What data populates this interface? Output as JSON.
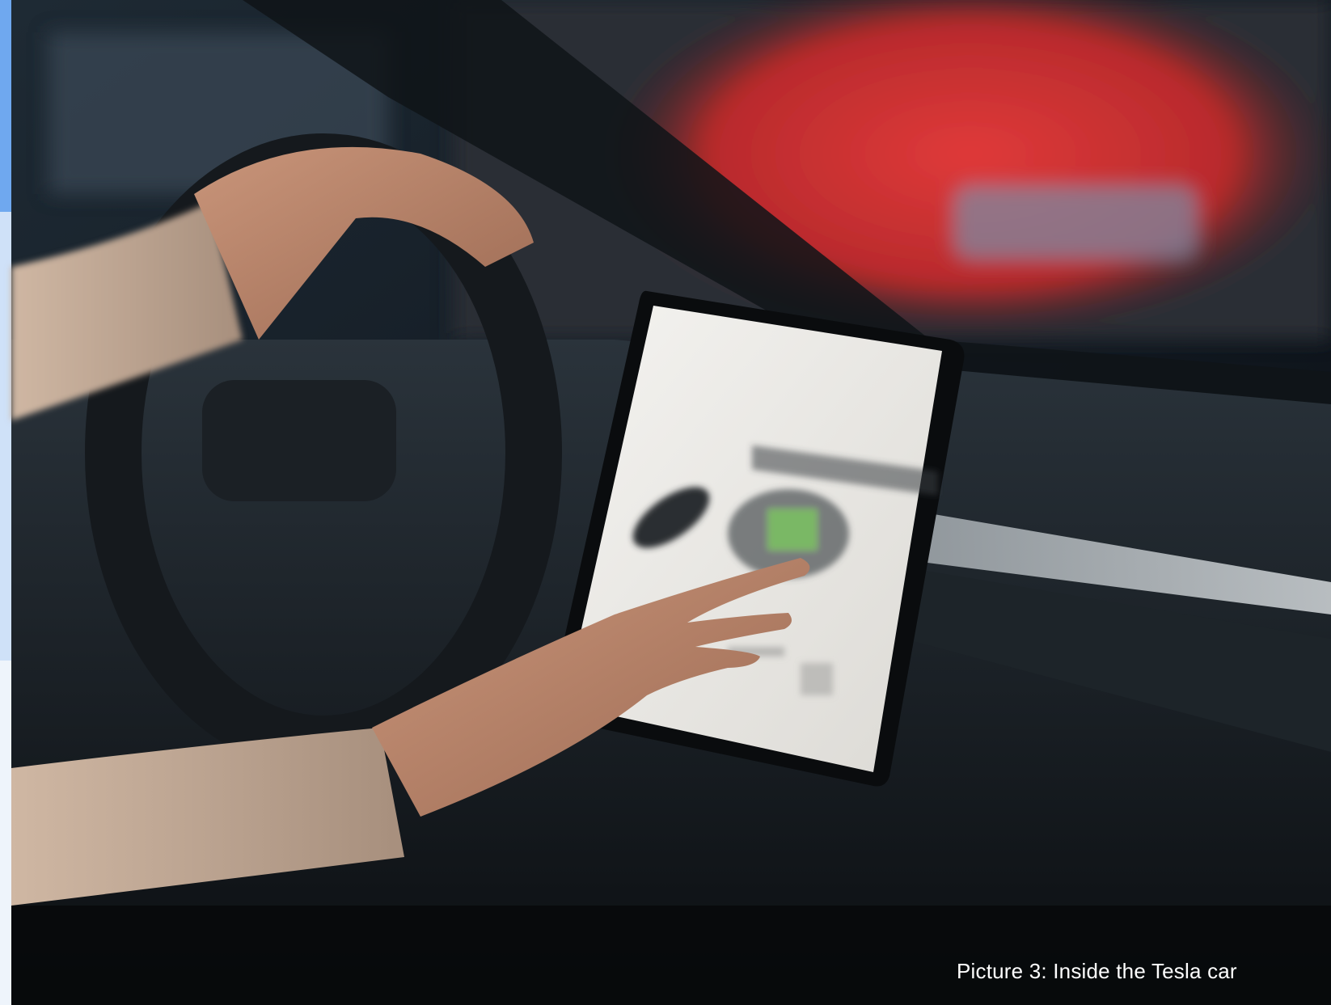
{
  "caption": "Picture 3: Inside the Tesla car",
  "colors": {
    "left_strip_top": "#6fa8ef",
    "left_strip_middle": "#cfe1f8",
    "left_strip_bottom": "#eef4fb",
    "background_red": "#e03a3a",
    "screen_highlight": "#7ab865"
  }
}
